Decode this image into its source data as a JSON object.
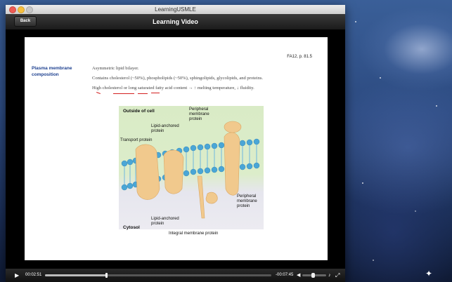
{
  "window": {
    "title": "LearningUSMLE"
  },
  "navbar": {
    "back_label": "Back",
    "title": "Learning Video"
  },
  "slide": {
    "reference": "FA12, p. 81.5",
    "section_heading": "Plasma membrane composition",
    "lines": [
      "Asymmetric lipid bilayer.",
      "Contains cholesterol (~50%), phospholipids (~50%), sphingolipids, glycolipids, and proteins.",
      "High cholesterol or long saturated fatty acid content → ↑ melting temperature, ↓ fluidity."
    ],
    "figure": {
      "outside_label": "Outside of cell",
      "cytosol_label": "Cytosol",
      "peripheral_top": "Peripheral membrane protein",
      "lipid_anchored_top": "Lipid-anchored protein",
      "transport_protein": "Transport protein",
      "lipid_anchored_bottom": "Lipid-anchored protein",
      "peripheral_bottom": "Peripheral membrane protein",
      "integral": "Integral membrane protein"
    }
  },
  "player": {
    "elapsed": "00:02:51",
    "remaining": "-00:07:45",
    "progress_fraction": 0.27,
    "volume_fraction": 0.45
  }
}
